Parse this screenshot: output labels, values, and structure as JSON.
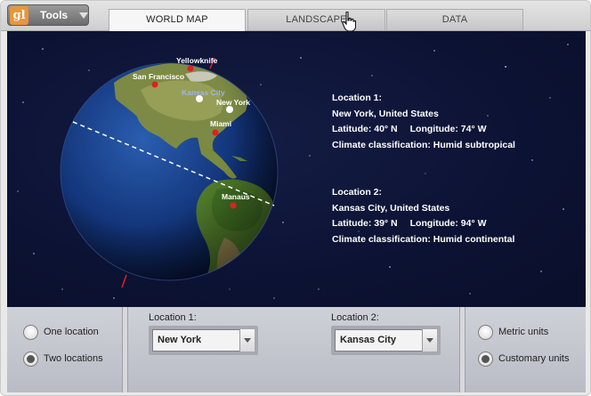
{
  "toolbar": {
    "tools_label": "Tools",
    "logo_glyph": "gl"
  },
  "tabs": [
    {
      "label": "WORLD MAP",
      "active": true
    },
    {
      "label": "LANDSCAPE",
      "active": false
    },
    {
      "label": "DATA",
      "active": false
    }
  ],
  "map": {
    "city_labels": [
      "Yellowknife",
      "San Francisco",
      "Kansas City",
      "New York",
      "Miami",
      "Manaus"
    ],
    "location1": {
      "heading": "Location 1:",
      "place": "New York, United States",
      "latitude": "Latitude: 40° N",
      "longitude": "Longitude: 74° W",
      "climate": "Climate classification: Humid subtropical"
    },
    "location2": {
      "heading": "Location 2:",
      "place": "Kansas City, United States",
      "latitude": "Latitude: 39° N",
      "longitude": "Longitude: 94° W",
      "climate": "Climate classification: Humid continental"
    }
  },
  "controls": {
    "count_options": [
      {
        "label": "One location",
        "selected": false
      },
      {
        "label": "Two locations",
        "selected": true
      }
    ],
    "location1_label": "Location 1:",
    "location1_value": "New York",
    "location2_label": "Location 2:",
    "location2_value": "Kansas City",
    "unit_options": [
      {
        "label": "Metric units",
        "selected": false
      },
      {
        "label": "Customary units",
        "selected": true
      }
    ]
  },
  "colors": {
    "space": "#0c1233",
    "accent_orange": "#e8963a",
    "city_marker": "#e02020"
  }
}
